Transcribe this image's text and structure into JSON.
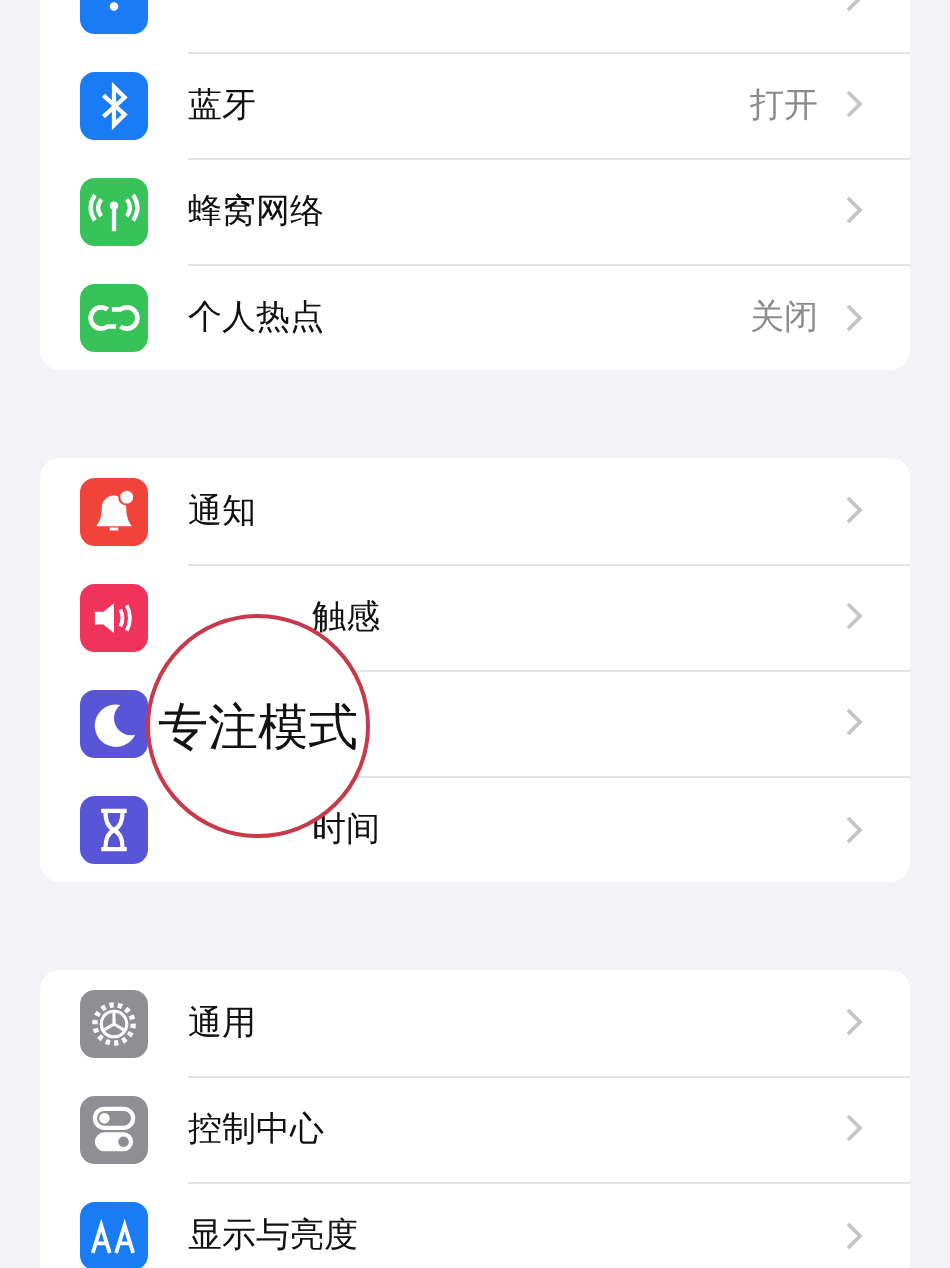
{
  "groups": [
    {
      "rows": [
        {
          "color": "#1a7cf5"
        },
        {
          "label": "蓝牙",
          "value": "打开",
          "color": "#1a7cf5"
        },
        {
          "label": "蜂窝网络",
          "color": "#38c25a"
        },
        {
          "label": "个人热点",
          "value": "关闭",
          "color": "#38c25a"
        }
      ]
    },
    {
      "rows": [
        {
          "label": "通知",
          "color": "#f0433a"
        },
        {
          "label": "触感",
          "covered": true,
          "color": "#f0335a"
        },
        {
          "color": "#5a55d6"
        },
        {
          "label": "时间",
          "covered": true,
          "color": "#5a55d6"
        }
      ]
    },
    {
      "rows": [
        {
          "label": "通用",
          "color": "#8e8e93"
        },
        {
          "label": "控制中心",
          "color": "#8e8e93"
        },
        {
          "label": "显示与亮度",
          "color": "#1a7cf5"
        }
      ]
    }
  ],
  "magnifier": {
    "text": "专注模式"
  }
}
